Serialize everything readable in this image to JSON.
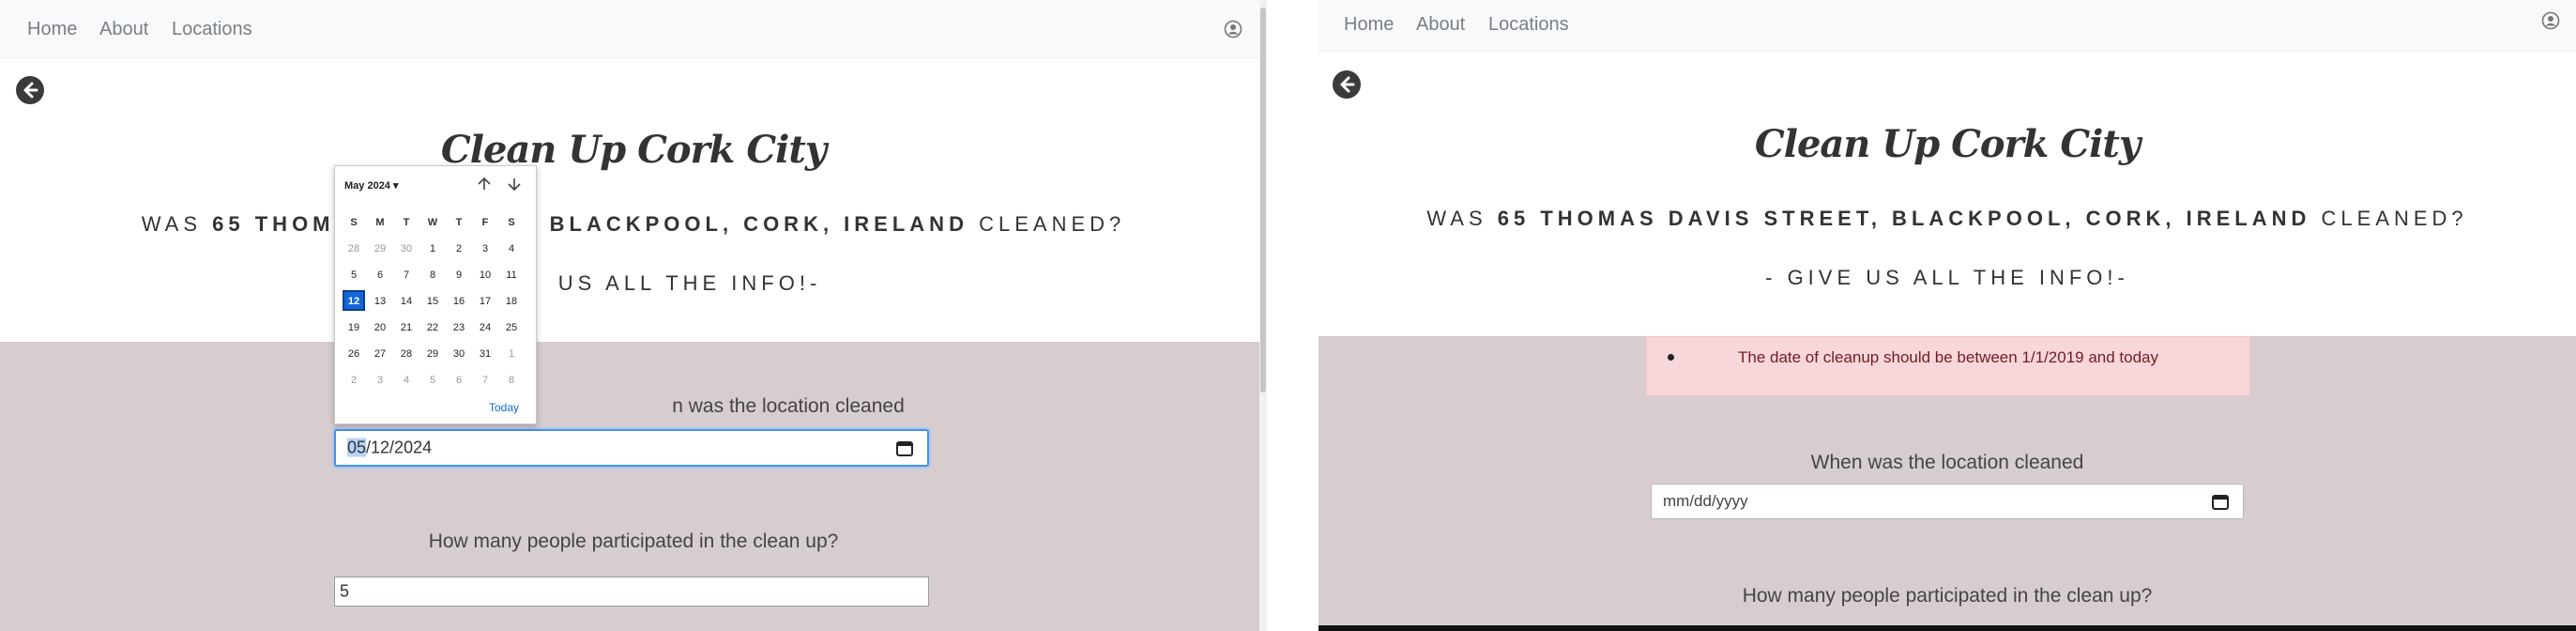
{
  "nav": {
    "home": "Home",
    "about": "About",
    "locations": "Locations"
  },
  "page": {
    "title": "Clean Up Cork City",
    "question_prefix": "WAS",
    "address": "65 THOMAS DAVIS STREET, BLACKPOOL, CORK, IRELAND",
    "question_suffix": "CLEANED?",
    "left_question_tail": "T, BLACKPOOL, CORK, IRELAND",
    "left_question_head": "65 THOMA",
    "info": "- GIVE US ALL THE INFO!-",
    "left_info_visible": "US ALL THE INFO!-"
  },
  "form": {
    "date_label": "When was the location cleaned",
    "date_label_left_visible": "n was the location cleaned",
    "date_value_left_sel": "05",
    "date_value_left_rest": "/12/2024",
    "date_placeholder": "mm/dd/yyyy",
    "people_label": "How many people participated in the clean up?",
    "people_value": "5",
    "error_message": "The date of cleanup should be between 1/1/2019 and today"
  },
  "calendar": {
    "month_label": "May 2024",
    "weekdays": [
      "S",
      "M",
      "T",
      "W",
      "T",
      "F",
      "S"
    ],
    "weeks": [
      [
        "28",
        "29",
        "30",
        "1",
        "2",
        "3",
        "4"
      ],
      [
        "5",
        "6",
        "7",
        "8",
        "9",
        "10",
        "11"
      ],
      [
        "12",
        "13",
        "14",
        "15",
        "16",
        "17",
        "18"
      ],
      [
        "19",
        "20",
        "21",
        "22",
        "23",
        "24",
        "25"
      ],
      [
        "26",
        "27",
        "28",
        "29",
        "30",
        "31",
        "1"
      ],
      [
        "2",
        "3",
        "4",
        "5",
        "6",
        "7",
        "8"
      ]
    ],
    "selected": "12",
    "today_label": "Today"
  },
  "colors": {
    "panel": "#d7cdcf",
    "accent": "#1467d6",
    "alert": "#f8d7da"
  }
}
